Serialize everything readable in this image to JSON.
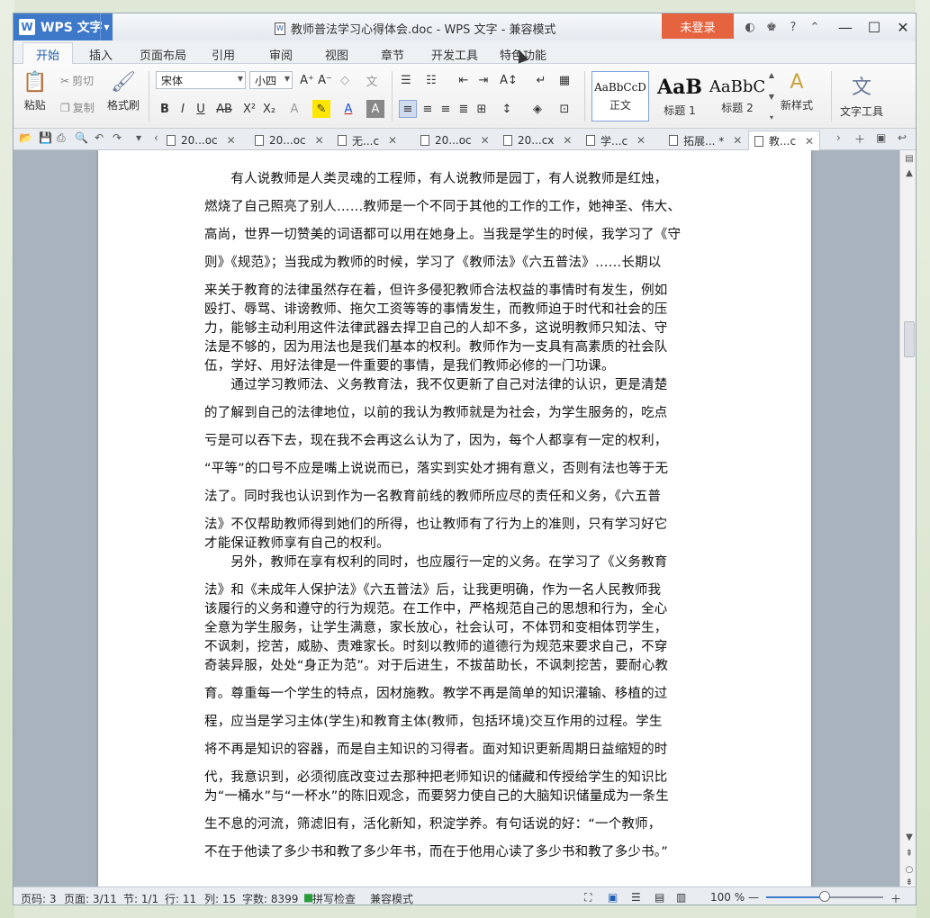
{
  "title_bar": {
    "app_button": "WPS 文字",
    "document_title": "教师普法学习心得体会.doc - WPS 文字 - 兼容模式",
    "login_button": "未登录"
  },
  "menu_tabs": [
    "开始",
    "插入",
    "页面布局",
    "引用",
    "审阅",
    "视图",
    "章节",
    "开发工具",
    "特色功能"
  ],
  "ribbon": {
    "paste": "粘贴",
    "cut": "剪切",
    "copy": "复制",
    "format_painter": "格式刷",
    "font_name": "宋体",
    "font_size": "小四",
    "styles": [
      {
        "sample": "AaBbCcD",
        "name": "正文"
      },
      {
        "sample": "AaB",
        "name": "标题 1"
      },
      {
        "sample": "AaBbC",
        "name": "标题 2"
      }
    ],
    "new_style": "新样式",
    "text_tools": "文字工具"
  },
  "doc_tabs": [
    {
      "label": "20...oc",
      "active": false
    },
    {
      "label": "20...oc",
      "active": false
    },
    {
      "label": "无...c",
      "active": false
    },
    {
      "label": "20...oc",
      "active": false
    },
    {
      "label": "20...cx",
      "active": false
    },
    {
      "label": "学...c",
      "active": false
    },
    {
      "label": "拓展... *",
      "active": false
    },
    {
      "label": "教...c",
      "active": true
    }
  ],
  "document_lines": [
    "　　有人说教师是人类灵魂的工程师，有人说教师是园丁，有人说教师是红烛，",
    "燃烧了自己照亮了别人……教师是一个不同于其他的工作的工作，她神圣、伟大、",
    "高尚，世界一切赞美的词语都可以用在她身上。当我是学生的时候，我学习了《守",
    "则》《规范》；当我成为教师的时候，学习了《教师法》《六五普法》……长期以",
    "来关于教育的法律虽然存在着，但许多侵犯教师合法权益的事情时有发生，例如",
    "殴打、辱骂、诽谤教师、拖欠工资等等的事情发生，而教师迫于时代和社会的压",
    "力，能够主动利用这件法律武器去捍卫自己的人却不多，这说明教师只知法、守",
    "法是不够的，因为用法也是我们基本的权利。教师作为一支具有高素质的社会队",
    "伍，学好、用好法律是一件重要的事情，是我们教师必修的一门功课。",
    "　　通过学习教师法、义务教育法，我不仅更新了自己对法律的认识，更是清楚",
    "的了解到自己的法律地位，以前的我认为教师就是为社会，为学生服务的，吃点",
    "亏是可以吞下去，现在我不会再这么认为了，因为，每个人都享有一定的权利，",
    "“平等”的口号不应是嘴上说说而已，落实到实处才拥有意义，否则有法也等于无",
    "法了。同时我也认识到作为一名教育前线的教师所应尽的责任和义务，《六五普",
    "法》不仅帮助教师得到她们的所得，也让教师有了行为上的准则，只有学习好它",
    "才能保证教师享有自己的权利。",
    "　　另外，教师在享有权利的同时，也应履行一定的义务。在学习了《义务教育",
    "法》和《未成年人保护法》《六五普法》后，让我更明确，作为一名人民教师我",
    "该履行的义务和遵守的行为规范。在工作中，严格规范自己的思想和行为，全心",
    "全意为学生服务，让学生满意，家长放心，社会认可，不体罚和变相体罚学生，",
    "不讽刺，挖苦，威胁、责难家长。时刻以教师的道德行为规范来要求自己，不穿",
    "奇装异服，处处“身正为范”。对于后进生，不拔苗助长，不讽刺挖苦，要耐心教",
    "育。尊重每一个学生的特点，因材施教。教学不再是简单的知识灌输、移植的过",
    "程，应当是学习主体(学生)和教育主体(教师，包括环境)交互作用的过程。学生",
    "将不再是知识的容器，而是自主知识的习得者。面对知识更新周期日益缩短的时",
    "代，我意识到，必须彻底改变过去那种把老师知识的储藏和传授给学生的知识比",
    "为“一桶水”与“一杯水”的陈旧观念，而要努力使自己的大脑知识储量成为一条生",
    "生不息的河流，筛滤旧有，活化新知，积淀学养。有句话说的好：“一个教师，",
    "不在于他读了多少书和教了多少年书，而在于他用心读了多少书和教了多少书。”"
  ],
  "status_bar": {
    "page_num": "页码: 3",
    "pages": "页面: 3/11",
    "section": "节: 1/1",
    "row": "行: 11",
    "col": "列: 15",
    "word_count": "字数: 8399",
    "spell_check": "拼写检查",
    "compat_mode": "兼容模式",
    "zoom": "100 %",
    "zoom_fraction": 0.5
  },
  "colors": {
    "wps_blue": "#3d78c9",
    "login_orange": "#e5633f",
    "active_tab_text": "#1f5fb4"
  }
}
